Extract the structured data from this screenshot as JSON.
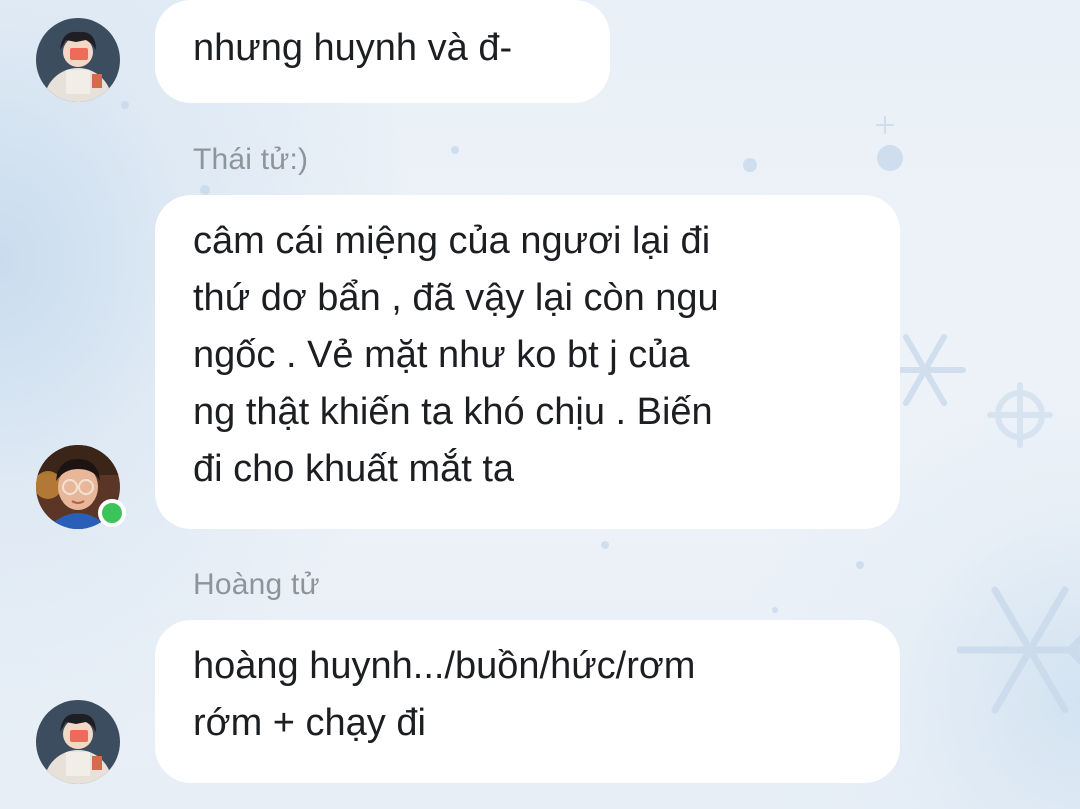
{
  "messages": [
    {
      "lines": [
        "nhưng huynh và đ-"
      ]
    },
    {
      "sender": "Thái tử:)",
      "lines": [
        "câm cái miệng của ngươi lại đi",
        "thứ dơ bẩn , đã vậy lại còn ngu",
        "ngốc . Vẻ mặt như ko bt j của",
        "ng thật khiến ta khó chịu . Biến",
        "đi cho khuất mắt ta"
      ],
      "online": true
    },
    {
      "sender": "Hoàng tử",
      "lines": [
        "hoàng huynh.../buồn/hức/rơm",
        "rớm + chạy đi"
      ]
    }
  ],
  "colors": {
    "bubble": "#ffffff",
    "sender_text": "#8d949c",
    "message_text": "#1c1e21",
    "online_indicator": "#3cc45a"
  },
  "icons": {
    "avatar_1": "cartoon-avatar",
    "avatar_2": "photo-avatar",
    "avatar_3": "cartoon-avatar"
  }
}
